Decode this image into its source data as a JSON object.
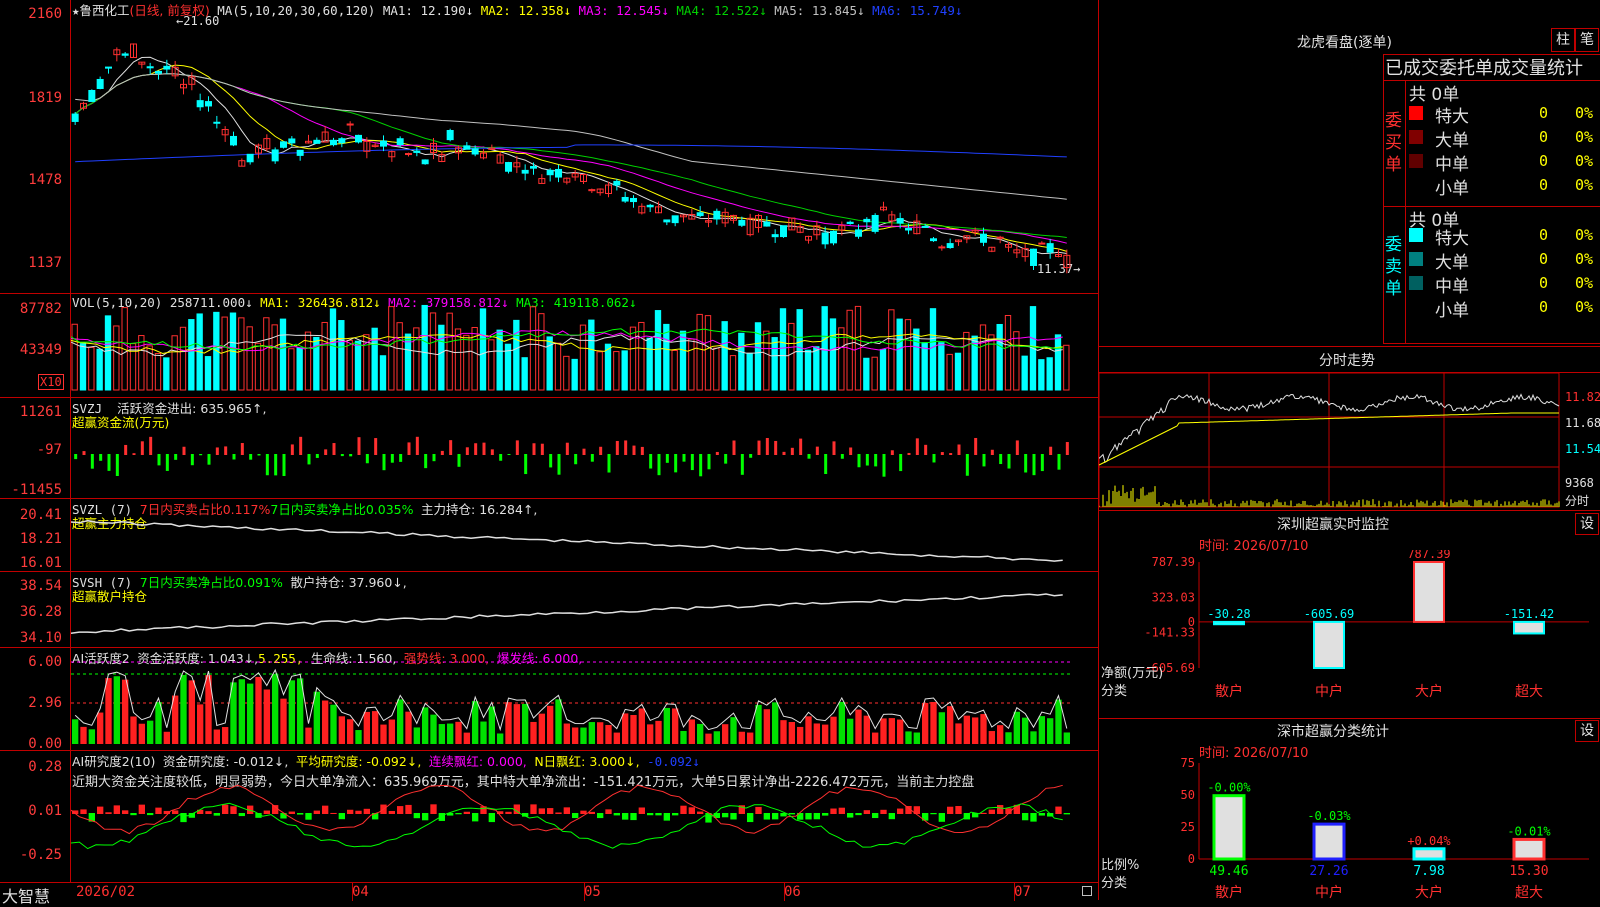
{
  "stock": {
    "name": "鲁西化工",
    "mode": "(日线, 前复权)"
  },
  "ma_header": {
    "prefix": "MA(5,10,20,30,60,120)",
    "items": [
      {
        "label": "MA1: 12.190↓",
        "color": "#e0e0e0"
      },
      {
        "label": "MA2: 12.358↓",
        "color": "#ffff00"
      },
      {
        "label": "MA3: 12.545↓",
        "color": "#ff00ff"
      },
      {
        "label": "MA4: 12.522↓",
        "color": "#00d000"
      },
      {
        "label": "MA5: 13.845↓",
        "color": "#c0c0c0"
      },
      {
        "label": "MA6: 15.749↓",
        "color": "#2040ff"
      }
    ]
  },
  "price_axis": [
    "2160",
    "1819",
    "1478",
    "1137"
  ],
  "price_high_label": "21.60",
  "price_low_label": "11.37",
  "vol_panel": {
    "prefix": "VOL(5,10,20)",
    "value": "258711.000↓",
    "ma1": "MA1: 326436.812↓",
    "ma2": "MA2: 379158.812↓",
    "ma3": "MA3: 419118.062↓",
    "axis": [
      "87782",
      "43349"
    ],
    "unit": "X10"
  },
  "svzj_panel": {
    "prefix": "SVZJ",
    "label": "活跃资金进出: 635.965↑,",
    "sub": "超赢资金流(万元)",
    "axis": [
      "11261",
      "-97",
      "-11455"
    ]
  },
  "svzl_panel": {
    "prefix": "SVZL (7)",
    "buy_ratio": "7日内买卖占比0.117%",
    "net_ratio": "7日内买卖净占比0.035%",
    "main": "主力持仓: 16.284↑,",
    "sub": "超赢主力持仓",
    "axis": [
      "20.41",
      "18.21",
      "16.01"
    ]
  },
  "svsh_panel": {
    "prefix": "SVSH (7)",
    "net_ratio": "7日内买卖净占比0.091%",
    "retail": "散户持仓: 37.960↓,",
    "sub": "超赢散户持仓",
    "axis": [
      "38.54",
      "36.28",
      "34.10"
    ]
  },
  "ai_active": {
    "prefix": "AI活跃度2",
    "degree": "资金活跃度: 1.043↓,",
    "v2": "5.255,",
    "life": "生命线: 1.560,",
    "strong": "强势线: 3.000,",
    "burst": "爆发线: 6.000,",
    "axis": [
      "6.00",
      "2.96",
      "0.00"
    ]
  },
  "ai_research": {
    "prefix": "AI研究度2(10)",
    "research": "资金研究度: -0.012↓,",
    "avg": "平均研究度: -0.092↓,",
    "cont": "连续飘红: 0.000,",
    "n_days": "N日飘红: 3.000↓,",
    "last": "-0.092↓",
    "commentary": "近期大资金关注度较低，明显弱势，今日大单净流入：635.969万元，其中特大单净流出：-151.421万元，大单5日累计净出-2226.472万元，当前主力控盘",
    "axis": [
      "0.28",
      "0.01",
      "-0.25"
    ]
  },
  "time_axis": [
    "2026/02",
    "04",
    "05",
    "06",
    "07"
  ],
  "brand": "大智慧",
  "right": {
    "dragon_title": "龙虎看盘(逐单)",
    "btn_zhu": "柱",
    "btn_bi": "笔",
    "order_title": "已成交委托单成交量统计",
    "buy_side": {
      "label": "委买单",
      "total": "共 0单",
      "rows": [
        {
          "name": "特大",
          "count": "0",
          "pct": "0%",
          "color": "#ff0000"
        },
        {
          "name": "大单",
          "count": "0",
          "pct": "0%",
          "color": "#800000"
        },
        {
          "name": "中单",
          "count": "0",
          "pct": "0%",
          "color": "#600000"
        },
        {
          "name": "小单",
          "count": "0",
          "pct": "0%",
          "color": "#000000"
        }
      ]
    },
    "sell_side": {
      "label": "委卖单",
      "total": "共 0单",
      "rows": [
        {
          "name": "特大",
          "count": "0",
          "pct": "0%",
          "color": "#00ffff"
        },
        {
          "name": "大单",
          "count": "0",
          "pct": "0%",
          "color": "#008080"
        },
        {
          "name": "中单",
          "count": "0",
          "pct": "0%",
          "color": "#006060"
        },
        {
          "name": "小单",
          "count": "0",
          "pct": "0%",
          "color": "#000000"
        }
      ]
    },
    "intraday_title": "分时走势",
    "intraday_axis": [
      "11.82",
      "11.68",
      "11.54"
    ],
    "intraday_vol": "9368",
    "intraday_unit": "分时",
    "monitor_title": "深圳超赢实时监控",
    "monitor_btn": "设",
    "monitor_time": "时间: 2026/07/10",
    "monitor_axis": [
      "787.39",
      "323.03",
      "0",
      "-141.33",
      "-605.69"
    ],
    "monitor_values": [
      -30.28,
      -605.69,
      787.39,
      -151.42
    ],
    "monitor_value_labels": [
      "-30.28",
      "-605.69",
      "787.39",
      "-151.42"
    ],
    "monitor_ylabel": "净额(万元)",
    "monitor_xlabel": "分类",
    "categories": [
      "散户",
      "中户",
      "大户",
      "超大"
    ],
    "class_title": "深市超赢分类统计",
    "class_btn": "设",
    "class_time": "时间: 2026/07/10",
    "class_axis": [
      "75",
      "50",
      "25",
      "0"
    ],
    "class_values": [
      49.46,
      27.26,
      7.98,
      15.3
    ],
    "class_value_labels": [
      "49.46",
      "27.26",
      "7.98",
      "15.30"
    ],
    "class_change_labels": [
      "-0.00%",
      "-0.03%",
      "+0.04%",
      "-0.01%"
    ],
    "class_ylabel": "比例%",
    "class_xlabel": "分类"
  },
  "colors": {
    "up": "#ff3030",
    "down": "#00ffff",
    "frame": "#c00000",
    "green": "#00ff00"
  }
}
